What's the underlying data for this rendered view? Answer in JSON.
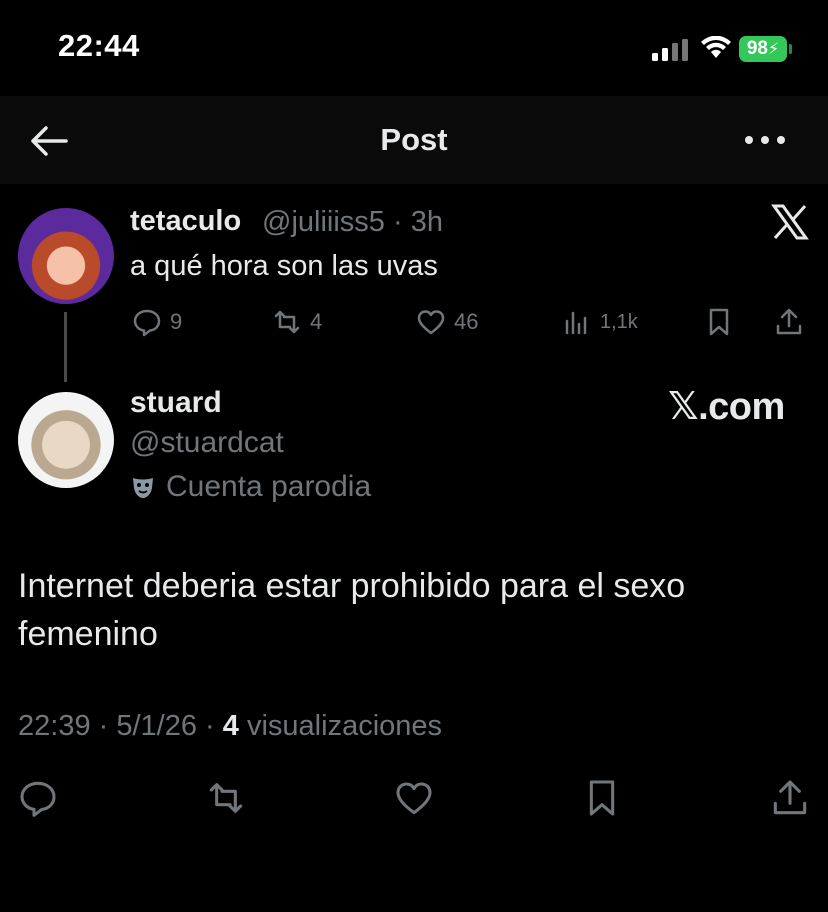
{
  "status_bar": {
    "time": "22:44",
    "battery": "98"
  },
  "header": {
    "title": "Post"
  },
  "parent_post": {
    "display_name": "tetaculo",
    "handle": "@juliiiss5",
    "time": "3h",
    "text": "a qué hora son las uvas",
    "replies": "9",
    "reposts": "4",
    "likes": "46",
    "views": "1,1k"
  },
  "main_post": {
    "display_name": "stuard",
    "handle": "@stuardcat",
    "badge": "Cuenta parodia",
    "watermark": "𝕏.com",
    "text": "Internet deberia estar prohibido para el sexo femenino",
    "time": "22:39",
    "date": "5/1/26",
    "views_count": "4",
    "views_label": "visualizaciones"
  }
}
